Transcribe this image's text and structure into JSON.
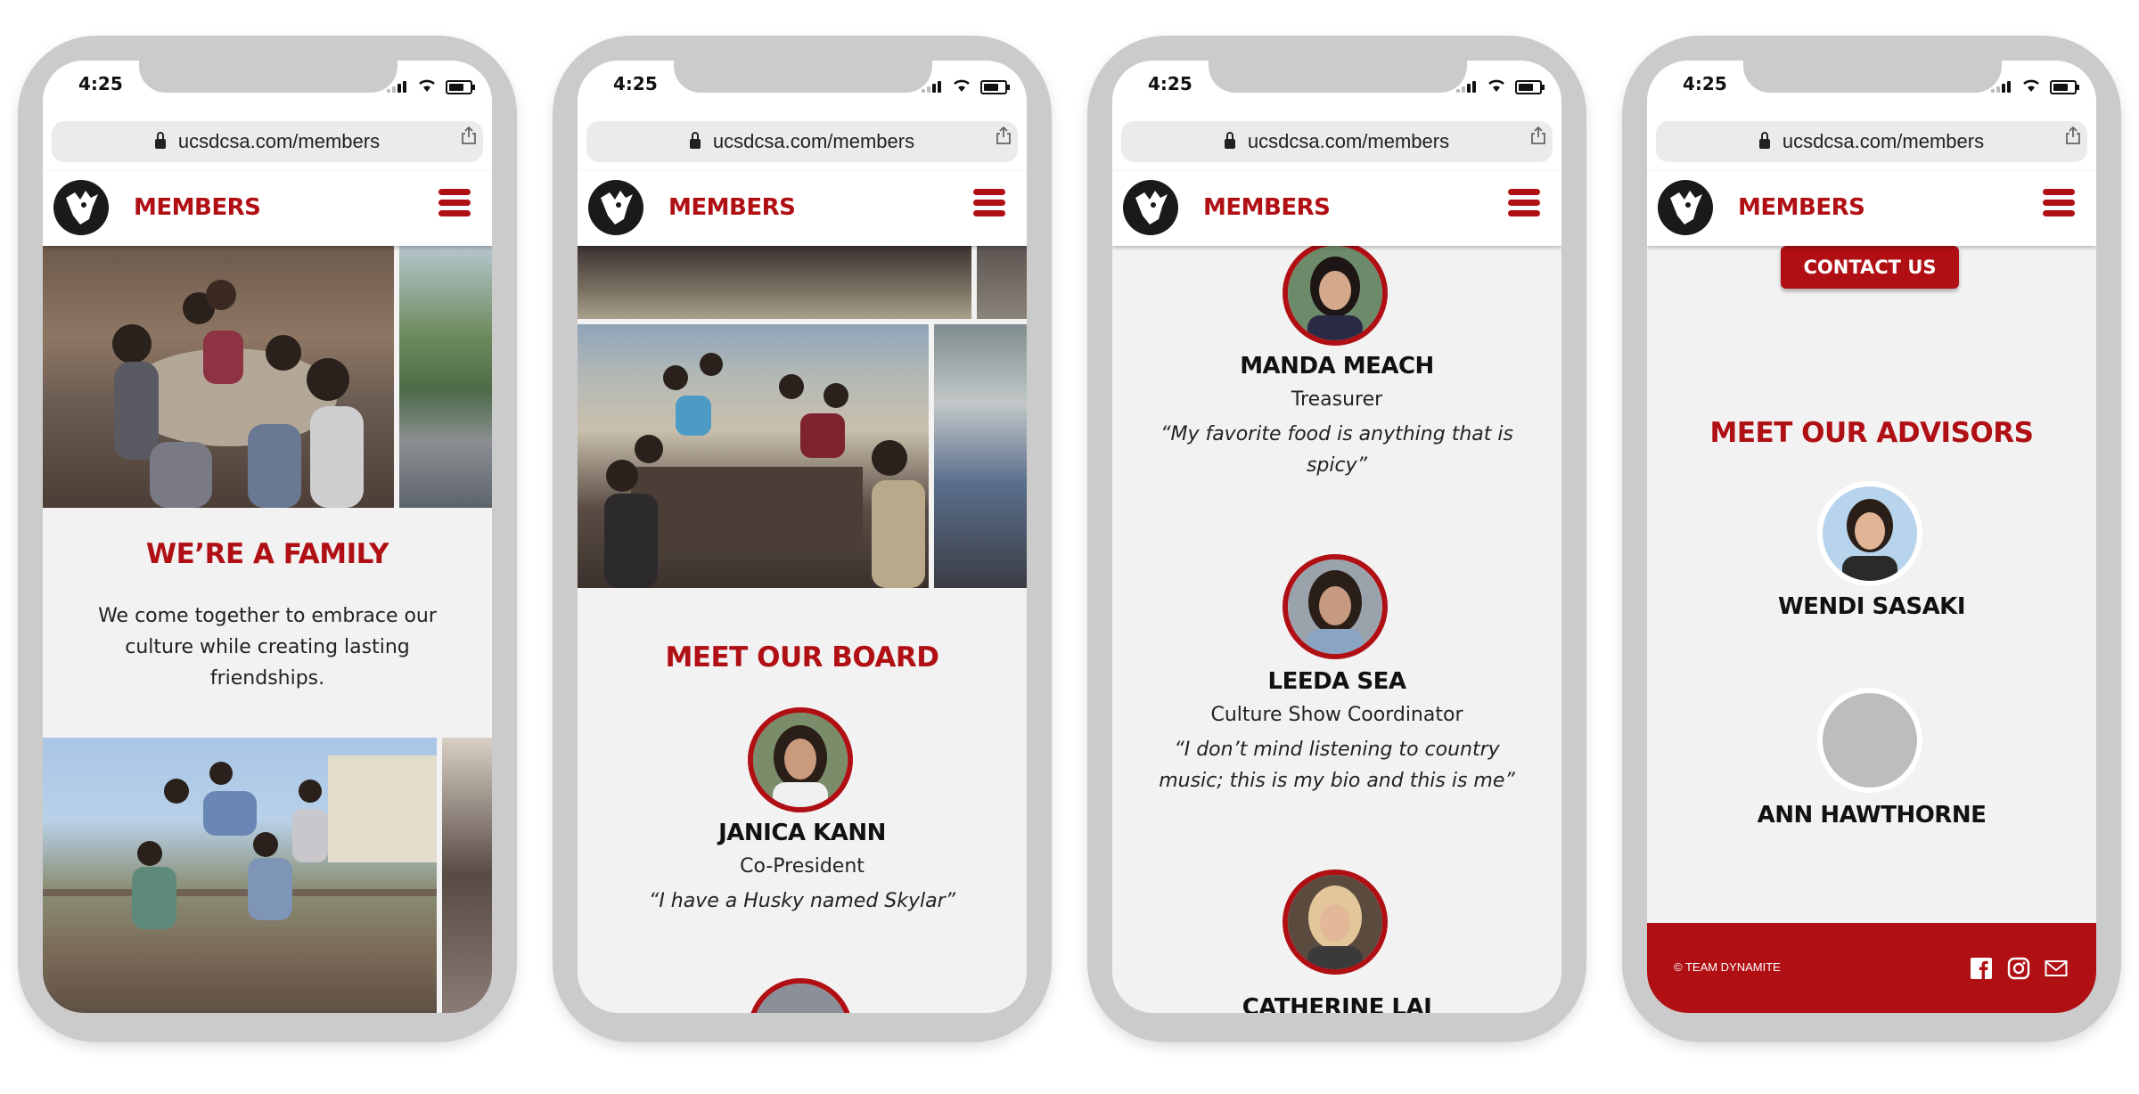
{
  "status": {
    "time": "4:25"
  },
  "browser": {
    "url": "ucsdcsa.com/members"
  },
  "nav": {
    "title": "MEMBERS"
  },
  "screen1": {
    "heading": "WE’RE A FAMILY",
    "text": "We come together to embrace our culture while creating lasting friendships."
  },
  "screen2": {
    "heading": "MEET OUR BOARD",
    "member": {
      "name": "JANICA KANN",
      "role": "Co-President",
      "quote": "“I have a Husky named Skylar”"
    }
  },
  "screen3": {
    "members": [
      {
        "name": "MANDA MEACH",
        "role": "Treasurer",
        "quote": "“My favorite food is anything that is spicy”"
      },
      {
        "name": "LEEDA SEA",
        "role": "Culture Show Coordinator",
        "quote": "“I don’t mind listening to country music; this is my bio and this is me”"
      },
      {
        "name": "CATHERINE LAI"
      }
    ]
  },
  "screen4": {
    "contact_button": "CONTACT US",
    "heading": "MEET OUR ADVISORS",
    "advisors": [
      {
        "name": "WENDI SASAKI"
      },
      {
        "name": "ANN HAWTHORNE"
      }
    ],
    "footer": {
      "copyright": "© TEAM DYNAMITE"
    }
  },
  "colors": {
    "brand_red": "#b00f14",
    "page_bg": "#f2f2f2",
    "frame": "#cbcbcb"
  },
  "icons": [
    "lock-icon",
    "share-icon",
    "hamburger-menu-icon",
    "facebook-icon",
    "instagram-icon",
    "mail-icon"
  ]
}
